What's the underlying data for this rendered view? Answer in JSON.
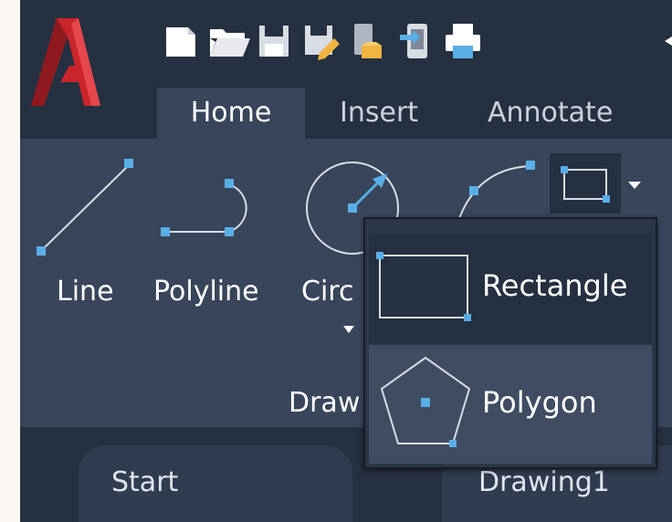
{
  "app": {
    "logo_letter": "A"
  },
  "qat": {
    "icons": [
      "new-file-icon",
      "open-folder-icon",
      "save-icon",
      "save-as-icon",
      "export-icon",
      "send-mobile-icon",
      "print-icon"
    ]
  },
  "ribbon_tabs": [
    {
      "label": "Home",
      "active": true
    },
    {
      "label": "Insert",
      "active": false
    },
    {
      "label": "Annotate",
      "active": false
    }
  ],
  "draw_panel": {
    "tools": [
      {
        "label": "Line",
        "icon": "line-icon"
      },
      {
        "label": "Polyline",
        "icon": "polyline-icon"
      },
      {
        "label": "Circ",
        "icon": "circle-icon"
      },
      {
        "label": "",
        "icon": "arc-icon"
      }
    ],
    "panel_title": "Draw",
    "split_button_icon": "rectangle-icon"
  },
  "flyout": {
    "items": [
      {
        "label": "Rectangle",
        "icon": "rectangle-icon"
      },
      {
        "label": "Polygon",
        "icon": "polygon-icon"
      }
    ]
  },
  "document_tabs": [
    {
      "label": "Start"
    },
    {
      "label": "Drawing1"
    }
  ],
  "colors": {
    "accent": "#5aaee6",
    "logo_red": "#d7262d",
    "dark_bg": "#253041",
    "ribbon_bg": "#38455b"
  }
}
